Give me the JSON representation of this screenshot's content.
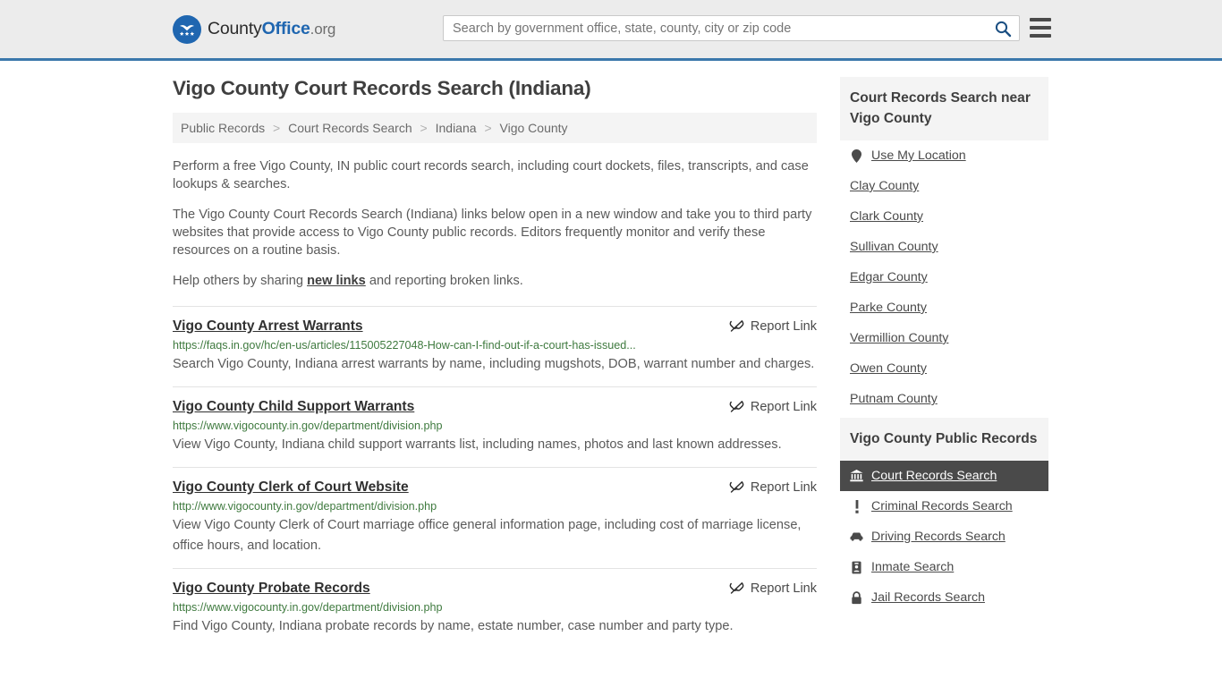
{
  "header": {
    "logo": {
      "part1": "County",
      "part2": "Office",
      "part3": ".org",
      "icon": "eagle-shield-emblem"
    },
    "search": {
      "placeholder": "Search by government office, state, county, city or zip code",
      "value": "",
      "icon": "search-icon"
    },
    "menu_icon": "hamburger-menu-icon",
    "accent_color": "#3b78ab"
  },
  "main": {
    "title": "Vigo County Court Records Search (Indiana)",
    "breadcrumb": [
      "Public Records",
      "Court Records Search",
      "Indiana",
      "Vigo County"
    ],
    "breadcrumb_separator": ">",
    "intro": {
      "p1": "Perform a free Vigo County, IN public court records search, including court dockets, files, transcripts, and case lookups & searches.",
      "p2": "The Vigo County Court Records Search (Indiana) links below open in a new window and take you to third party websites that provide access to Vigo County public records. Editors frequently monitor and verify these resources on a routine basis.",
      "p3_before": "Help others by sharing ",
      "p3_link": "new links",
      "p3_after": " and reporting broken links."
    },
    "report_link_label": "Report Link",
    "report_link_icon": "broken-link-icon",
    "results": [
      {
        "title": "Vigo County Arrest Warrants",
        "url": "https://faqs.in.gov/hc/en-us/articles/115005227048-How-can-I-find-out-if-a-court-has-issued...",
        "description": "Search Vigo County, Indiana arrest warrants by name, including mugshots, DOB, warrant number and charges."
      },
      {
        "title": "Vigo County Child Support Warrants",
        "url": "https://www.vigocounty.in.gov/department/division.php",
        "description": "View Vigo County, Indiana child support warrants list, including names, photos and last known addresses."
      },
      {
        "title": "Vigo County Clerk of Court Website",
        "url": "http://www.vigocounty.in.gov/department/division.php",
        "description": "View Vigo County Clerk of Court marriage office general information page, including cost of marriage license, office hours, and location."
      },
      {
        "title": "Vigo County Probate Records",
        "url": "https://www.vigocounty.in.gov/department/division.php",
        "description": "Find Vigo County, Indiana probate records by name, estate number, case number and party type."
      }
    ]
  },
  "sidebar": {
    "nearby": {
      "heading": "Court Records Search near Vigo County",
      "use_my_location": {
        "label": "Use My Location",
        "icon": "map-pin-icon"
      },
      "counties": [
        "Clay County",
        "Clark County",
        "Sullivan County",
        "Edgar County",
        "Parke County",
        "Vermillion County",
        "Owen County",
        "Putnam County"
      ]
    },
    "public_records": {
      "heading": "Vigo County Public Records",
      "items": [
        {
          "label": "Court Records Search",
          "icon": "courthouse-icon",
          "active": true
        },
        {
          "label": "Criminal Records Search",
          "icon": "exclamation-icon",
          "active": false
        },
        {
          "label": "Driving Records Search",
          "icon": "car-icon",
          "active": false
        },
        {
          "label": "Inmate Search",
          "icon": "id-badge-icon",
          "active": false
        },
        {
          "label": "Jail Records Search",
          "icon": "lock-icon",
          "active": false
        }
      ]
    }
  }
}
